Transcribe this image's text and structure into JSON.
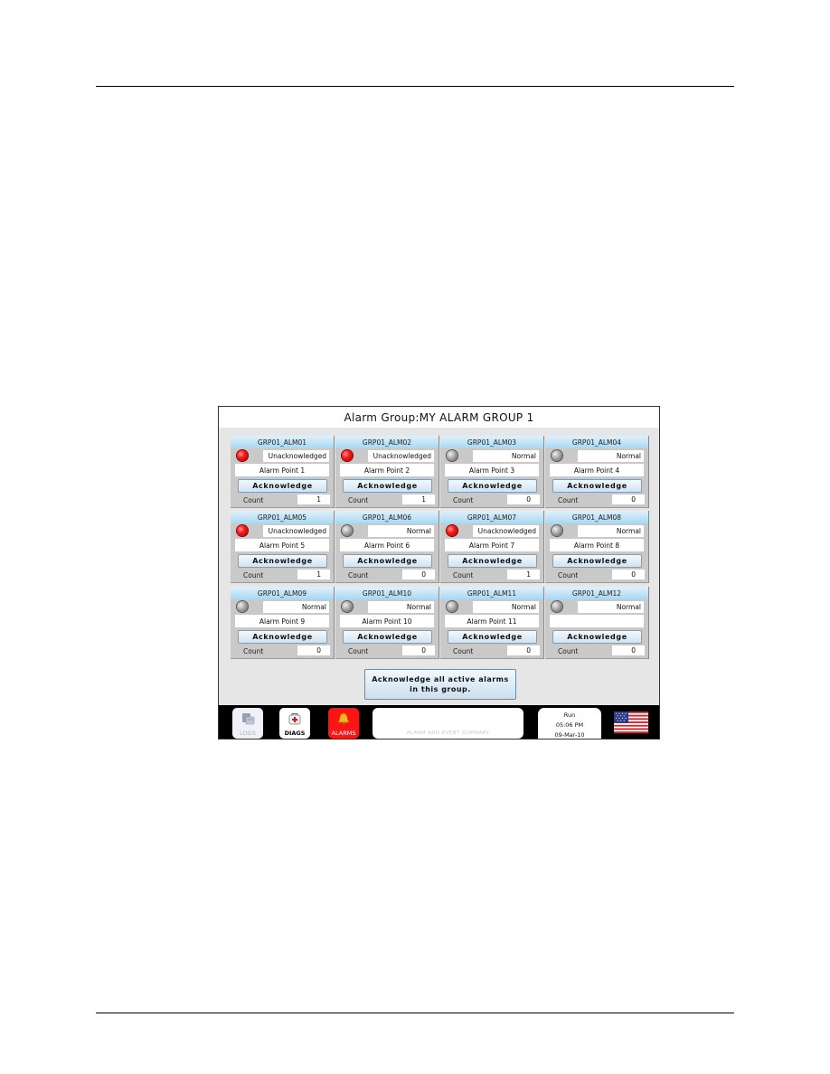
{
  "screen": {
    "title_prefix": "Alarm Group:",
    "group_name": "MY ALARM GROUP 1",
    "alarms": [
      {
        "tag": "GRP01_ALM01",
        "state": "active",
        "status": "Unacknowledged",
        "point": "Alarm Point 1",
        "ack_label": "Acknowledge",
        "count_label": "Count",
        "count": "1"
      },
      {
        "tag": "GRP01_ALM02",
        "state": "active",
        "status": "Unacknowledged",
        "point": "Alarm Point 2",
        "ack_label": "Acknowledge",
        "count_label": "Count",
        "count": "1"
      },
      {
        "tag": "GRP01_ALM03",
        "state": "normal",
        "status": "Normal",
        "point": "Alarm Point 3",
        "ack_label": "Acknowledge",
        "count_label": "Count",
        "count": "0"
      },
      {
        "tag": "GRP01_ALM04",
        "state": "normal",
        "status": "Normal",
        "point": "Alarm Point 4",
        "ack_label": "Acknowledge",
        "count_label": "Count",
        "count": "0"
      },
      {
        "tag": "GRP01_ALM05",
        "state": "active",
        "status": "Unacknowledged",
        "point": "Alarm Point 5",
        "ack_label": "Acknowledge",
        "count_label": "Count",
        "count": "1"
      },
      {
        "tag": "GRP01_ALM06",
        "state": "normal",
        "status": "Normal",
        "point": "Alarm Point 6",
        "ack_label": "Acknowledge",
        "count_label": "Count",
        "count": "0"
      },
      {
        "tag": "GRP01_ALM07",
        "state": "active",
        "status": "Unacknowledged",
        "point": "Alarm Point 7",
        "ack_label": "Acknowledge",
        "count_label": "Count",
        "count": "1"
      },
      {
        "tag": "GRP01_ALM08",
        "state": "normal",
        "status": "Normal",
        "point": "Alarm Point 8",
        "ack_label": "Acknowledge",
        "count_label": "Count",
        "count": "0"
      },
      {
        "tag": "GRP01_ALM09",
        "state": "normal",
        "status": "Normal",
        "point": "Alarm Point 9",
        "ack_label": "Acknowledge",
        "count_label": "Count",
        "count": "0"
      },
      {
        "tag": "GRP01_ALM10",
        "state": "normal",
        "status": "Normal",
        "point": "Alarm Point 10",
        "ack_label": "Acknowledge",
        "count_label": "Count",
        "count": "0"
      },
      {
        "tag": "GRP01_ALM11",
        "state": "normal",
        "status": "Normal",
        "point": "Alarm Point 11",
        "ack_label": "Acknowledge",
        "count_label": "Count",
        "count": "0"
      },
      {
        "tag": "GRP01_ALM12",
        "state": "normal",
        "status": "Normal",
        "point": "",
        "ack_label": "Acknowledge",
        "count_label": "Count",
        "count": "0"
      }
    ],
    "ack_all_line1": "Acknowledge all active alarms",
    "ack_all_line2": "in this group.",
    "lamp_colors": {
      "active": "#e01010",
      "normal": "#8c8c8c"
    }
  },
  "bottom_bar": {
    "logs": {
      "label": "LOGS",
      "icon": "logs-icon"
    },
    "diags": {
      "label": "DIAGS",
      "icon": "medical-kit-icon"
    },
    "alarms": {
      "label": "ALARMS",
      "icon": "bell-icon",
      "color": "#ff1414"
    },
    "summary_label": "ALARM AND EVENT SUMMARY",
    "clock": {
      "mode": "Run",
      "time": "05:06 PM",
      "date": "09-Mar-10"
    },
    "language_flag": "us-flag-icon"
  }
}
